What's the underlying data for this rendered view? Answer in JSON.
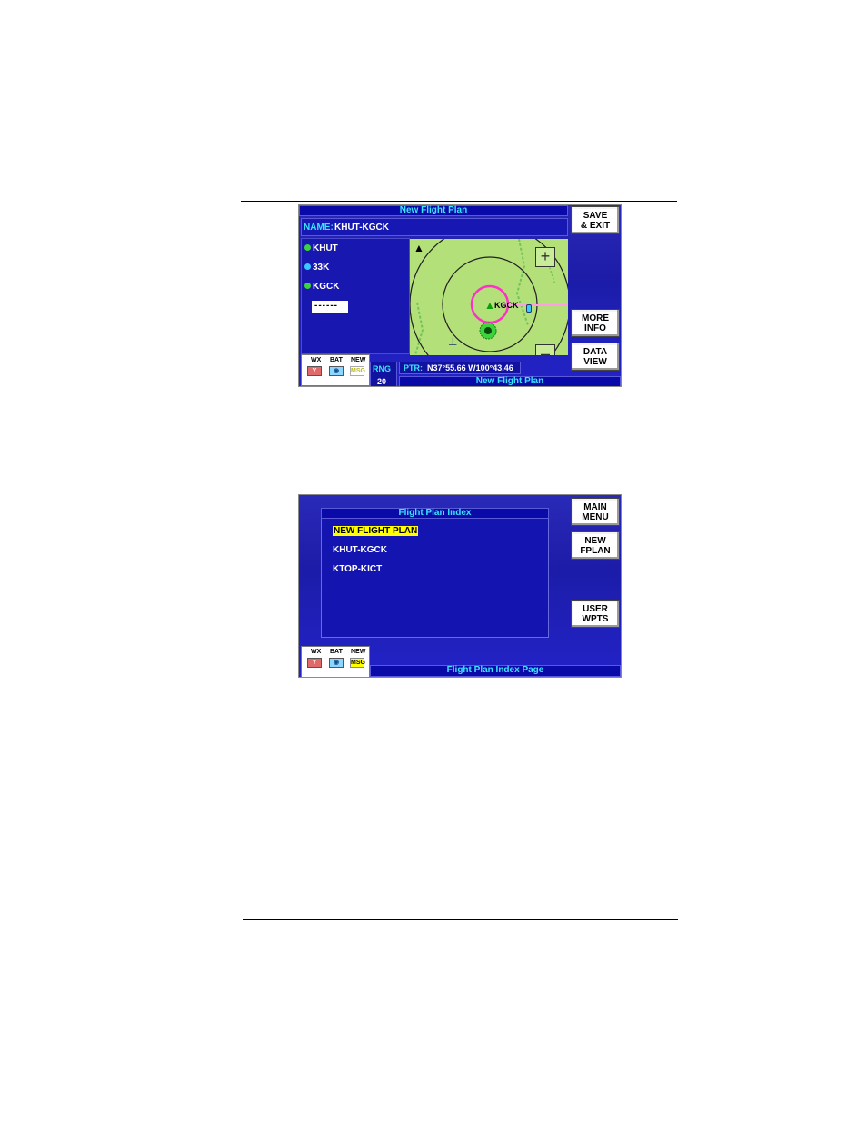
{
  "screen1": {
    "header_title": "New Flight Plan",
    "name_label": "NAME:",
    "name_value": "KHUT-KGCK",
    "waypoints": [
      {
        "id": "KHUT",
        "color": "#3cd43c"
      },
      {
        "id": "33K",
        "color": "#39c8ff"
      },
      {
        "id": "KGCK",
        "color": "#3cd43c"
      }
    ],
    "entry_placeholder": "------",
    "softkeys": {
      "save_exit": [
        "SAVE",
        "& EXIT"
      ],
      "more_info": [
        "MORE",
        "INFO"
      ],
      "data_view": [
        "DATA",
        "VIEW"
      ]
    },
    "map": {
      "airport_label": "KGCK",
      "zoom_in_icon": "plus-icon",
      "zoom_out_icon": "minus-icon",
      "north_icon": "north-arrow-icon"
    },
    "status": {
      "wx": "WX",
      "bat": "BAT",
      "new_line1": "NEW",
      "new_line2": "MSG"
    },
    "range": {
      "label": "RNG",
      "value": "20"
    },
    "pointer": {
      "label": "PTR:",
      "value": "N37°55.66 W100°43.46"
    },
    "footer_title": "New Flight Plan"
  },
  "screen2": {
    "index_title": "Flight Plan Index",
    "items": [
      {
        "label": "NEW FLIGHT PLAN",
        "selected": true
      },
      {
        "label": "KHUT-KGCK",
        "selected": false
      },
      {
        "label": "KTOP-KICT",
        "selected": false
      }
    ],
    "softkeys": {
      "main_menu": [
        "MAIN",
        "MENU"
      ],
      "new_fplan": [
        "NEW",
        "FPLAN"
      ],
      "user_wpts": [
        "USER",
        "WPTS"
      ]
    },
    "status": {
      "wx": "WX",
      "bat": "BAT",
      "new_line1": "NEW",
      "new_line2": "MSG"
    },
    "footer_title": "Flight Plan Index Page"
  },
  "colors": {
    "cyan_text": "#39e6ff",
    "screen_blue": "#1c1ca8",
    "map_green": "#b4e07a",
    "highlight_yellow": "#ffff00",
    "magenta_route": "#ff30c8"
  }
}
